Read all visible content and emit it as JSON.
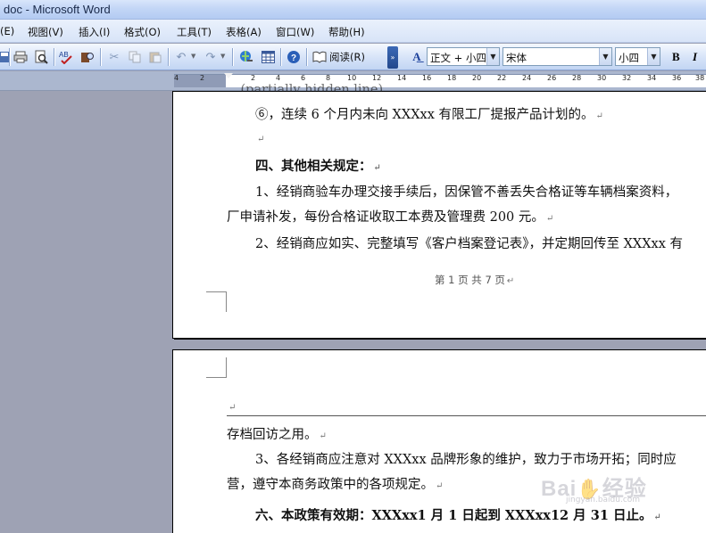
{
  "window": {
    "title": "doc - Microsoft Word"
  },
  "menu": {
    "items": [
      "(E)",
      "视图(V)",
      "插入(I)",
      "格式(O)",
      "工具(T)",
      "表格(A)",
      "窗口(W)",
      "帮助(H)"
    ]
  },
  "toolbar": {
    "read_label": "阅读(R)",
    "style_value": "正文 + 小四",
    "font_value": "宋体",
    "size_value": "小四",
    "bold_label": "B",
    "italic_label": "I",
    "icons": [
      "save-icon",
      "print-icon",
      "print-preview-icon",
      "spelling-icon",
      "research-icon",
      "cut-icon",
      "copy-icon",
      "paste-icon",
      "undo-icon",
      "redo-icon",
      "hyperlink-icon",
      "table-icon",
      "help-icon",
      "read-icon",
      "styles-icon"
    ]
  },
  "ruler": {
    "ticks": [
      "4",
      "2",
      "2",
      "4",
      "6",
      "8",
      "10",
      "12",
      "14",
      "16",
      "18",
      "20",
      "22",
      "24",
      "26",
      "28",
      "30",
      "32",
      "34",
      "36",
      "38"
    ]
  },
  "document": {
    "page1": {
      "line_partial": "…(partially hidden line)…",
      "line_6": "⑥，连续 6 个月内未向 XXXxx 有限工厂提报产品计划的。",
      "heading_4": "四、其他相关规定：",
      "p1_line1": "1、经销商验车办理交接手续后，因保管不善丢失合格证等车辆档案资料，",
      "p1_line2": "厂申请补发，每份合格证收取工本费及管理费 200 元。",
      "p2_line1": "2、经销商应如实、完整填写《客户档案登记表》，并定期回传至 XXXxx 有",
      "footer": "第 1 页 共 7 页"
    },
    "page2": {
      "line_a": "存档回访之用。",
      "p3_line1": "3、各经销商应注意对 XXXxx 品牌形象的维护，致力于市场开拓；同时应",
      "p3_line2": "营，遵守本商务政策中的各项规定。",
      "heading_6": "六、本政策有效期：XXXxx1 月 1 日起到 XXXxx12 月 31 日止。"
    }
  },
  "watermark": {
    "text": "Bai",
    "text2": "经验",
    "sub": "jingyan.baidu.com"
  }
}
